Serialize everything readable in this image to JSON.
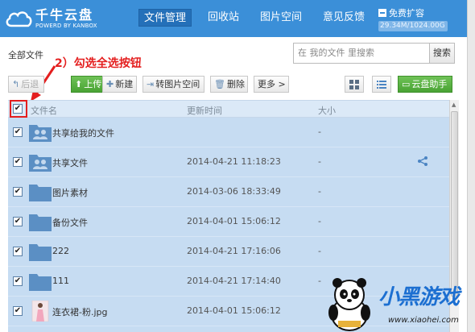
{
  "header": {
    "logo_title": "千牛云盘",
    "logo_subtitle": "POWERD BY KANBOX",
    "nav": [
      "文件管理",
      "回收站",
      "图片空间",
      "意见反馈"
    ],
    "expand_label": "免费扩容",
    "quota": "29.34M/1024.00G",
    "colors": {
      "brand": "#3b8fd8",
      "nav_active": "#2470b9"
    }
  },
  "path": {
    "label": "全部文件"
  },
  "search": {
    "placeholder": "在 我的文件 里搜索",
    "button": "搜索"
  },
  "toolbar": {
    "back": "后退",
    "upload": "上传",
    "new_folder": "新建",
    "to_image_space": "转图片空间",
    "delete": "删除",
    "more": "更多 >",
    "helper": "云盘助手",
    "icons": [
      "back-arrow-icon",
      "upload-icon",
      "plus-icon",
      "transfer-icon",
      "trash-icon",
      "grid-view-icon",
      "list-view-icon",
      "monitor-icon"
    ]
  },
  "annotation": {
    "text": "2）勾选全选按钮",
    "color": "#e41e1e"
  },
  "table": {
    "columns": {
      "name": "文件名",
      "time": "更新时间",
      "size": "大小"
    },
    "all_checked": true,
    "rows": [
      {
        "name": "共享给我的文件",
        "time": "",
        "size": "-",
        "icon": "shared-folder-icon",
        "checked": true,
        "share": false
      },
      {
        "name": "共享文件",
        "time": "2014-04-21 11:18:23",
        "size": "-",
        "icon": "shared-folder-icon",
        "checked": true,
        "share": true
      },
      {
        "name": "图片素材",
        "time": "2014-03-06 18:33:49",
        "size": "-",
        "icon": "folder-icon",
        "checked": true,
        "share": false
      },
      {
        "name": "备份文件",
        "time": "2014-04-01 15:06:12",
        "size": "-",
        "icon": "folder-icon",
        "checked": true,
        "share": false
      },
      {
        "name": "222",
        "time": "2014-04-21 17:16:06",
        "size": "-",
        "icon": "folder-icon",
        "checked": true,
        "share": false
      },
      {
        "name": "111",
        "time": "2014-04-21 17:14:40",
        "size": "-",
        "icon": "folder-icon",
        "checked": true,
        "share": false
      },
      {
        "name": "连衣裙-粉.jpg",
        "time": "2014-04-01 15:06:12",
        "size": "",
        "icon": "image-thumbnail-icon",
        "checked": true,
        "share": false
      }
    ]
  },
  "watermark": {
    "brand": "小黑游戏",
    "url": "www.xiaohei.com"
  }
}
